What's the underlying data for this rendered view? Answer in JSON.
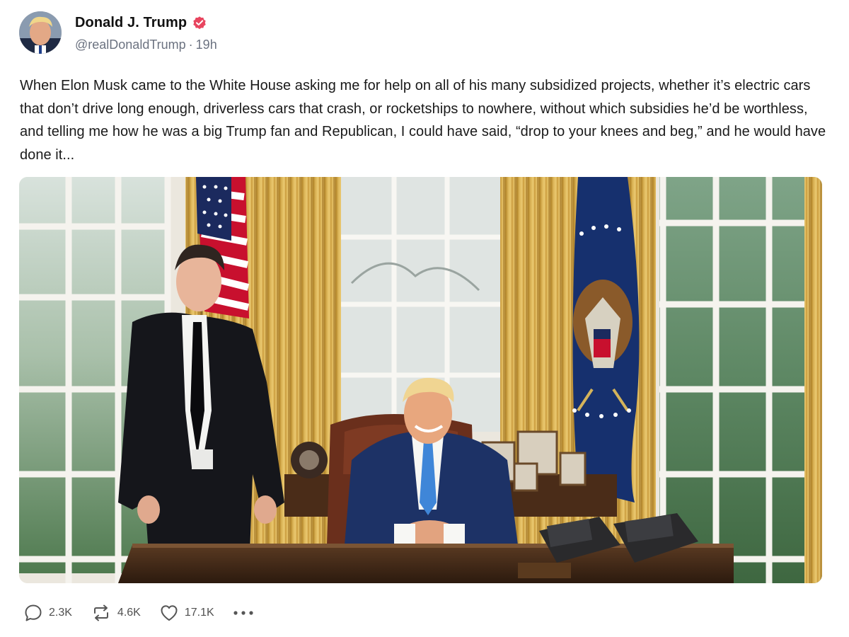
{
  "post": {
    "author": {
      "name": "Donald J. Trump",
      "handle": "@realDonaldTrump",
      "separator": "·",
      "time": "19h",
      "verified": true,
      "avatar_icon": "profile-photo"
    },
    "text": "When Elon Musk came to the White House asking me for help on all of his many subsidized projects, whether it’s electric cars that don’t drive long enough, driverless cars that crash, or rocketships to nowhere, without which subsidies he’d be worthless, and telling me how he was a big Trump fan and Republican, I could have said, “drop to your knees and beg,” and he would have done it...",
    "media": {
      "type": "photo"
    },
    "actions": {
      "replies": "2.3K",
      "reposts": "4.6K",
      "likes": "17.1K",
      "reply_icon": "speech-bubble-icon",
      "repost_icon": "repost-arrows-icon",
      "like_icon": "heart-icon",
      "more_icon": "ellipsis-icon"
    }
  },
  "colors": {
    "verified_badge": "#e8455f",
    "text": "#1a1a1a",
    "muted": "#6b7280"
  }
}
